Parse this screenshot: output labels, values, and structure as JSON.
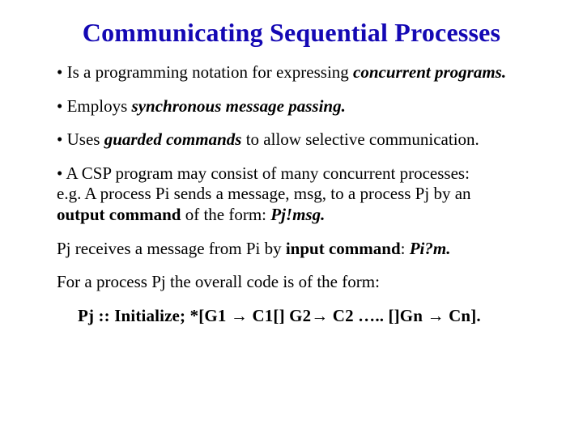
{
  "title": "Communicating Sequential Processes",
  "b1_lead": "• Is a programming notation",
  "b1_mid": " for expressing ",
  "b1_em": "concurrent programs.",
  "b2_lead": "• Employs ",
  "b2_em": "synchronous message passing.",
  "b3_lead": "• Uses ",
  "b3_em": "guarded commands",
  "b3_tail": " to allow selective communication.",
  "b4_l1": "• A CSP program may consist of many concurrent processes:",
  "b4_l2": "e.g. A process Pi sends a message, msg, to a process Pj by an",
  "b4_l3a": "output command",
  "b4_l3b": " of the form:    ",
  "b4_l3c": "Pj!msg.",
  "p5_a": "Pj receives a message from Pi by ",
  "p5_b": "input command",
  "p5_c": ":  ",
  "p5_d": "Pi?m.",
  "p6": "For a process Pj the overall code is of the form:",
  "code_a": "Pj :: Initialize; *[G1 ",
  "code_b": " C1[]  G2",
  "code_c": " C2 ….. []Gn ",
  "code_d": " Cn].",
  "arrow": "→"
}
